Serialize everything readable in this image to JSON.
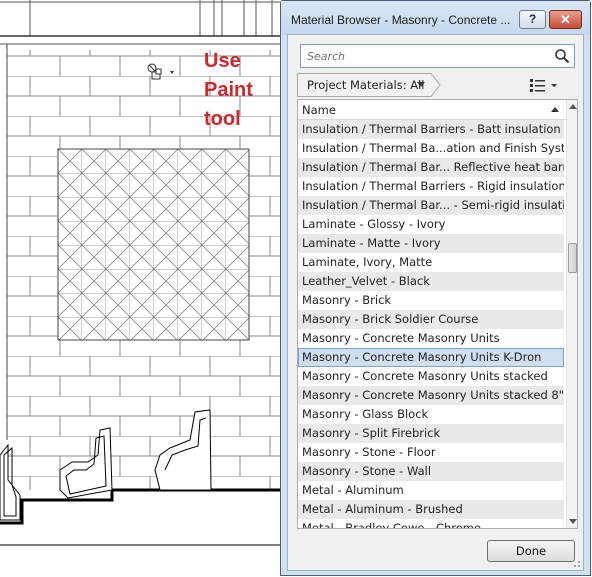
{
  "annotation": {
    "lines": [
      "Use",
      "Paint",
      "tool"
    ],
    "color": "#d1262b"
  },
  "dialog": {
    "title": "Material Browser - Masonry - Concrete ...",
    "help_label": "?",
    "close_label": "✕",
    "search": {
      "placeholder": "Search",
      "value": ""
    },
    "filter": {
      "label": "Project Materials: All"
    },
    "list": {
      "header": "Name",
      "items": [
        "Insulation / Thermal Barriers - Batt insulation",
        "Insulation / Thermal Ba...ation and Finish System",
        "Insulation / Thermal Bar... Reflective heat barrier",
        "Insulation / Thermal Barriers - Rigid insulation",
        "Insulation / Thermal Bar... - Semi-rigid insulation",
        "Laminate - Glossy - Ivory",
        "Laminate - Matte - Ivory",
        "Laminate, Ivory, Matte",
        "Leather_Velvet - Black",
        "Masonry - Brick",
        "Masonry - Brick Soldier Course",
        "Masonry - Concrete Masonry Units",
        "Masonry - Concrete Masonry Units K-Dron",
        "Masonry - Concrete Masonry Units stacked",
        "Masonry - Concrete Masonry Units stacked 8\"",
        "Masonry - Glass Block",
        "Masonry - Split Firebrick",
        "Masonry - Stone - Floor",
        "Masonry - Stone - Wall",
        "Metal - Aluminum",
        "Metal - Aluminum - Brushed",
        "Metal - Bradley Cowe - Chrome"
      ],
      "selected_index": 12
    },
    "done_label": "Done",
    "colors": {
      "selection": "#cfdef2",
      "selection_border": "#7da2ce",
      "frame": "#cfe0f1"
    }
  },
  "icons": {
    "view_control": "view-control-icon",
    "search": "search-icon",
    "list_view": "list-view-icon",
    "close": "close-icon",
    "help": "help-icon"
  }
}
